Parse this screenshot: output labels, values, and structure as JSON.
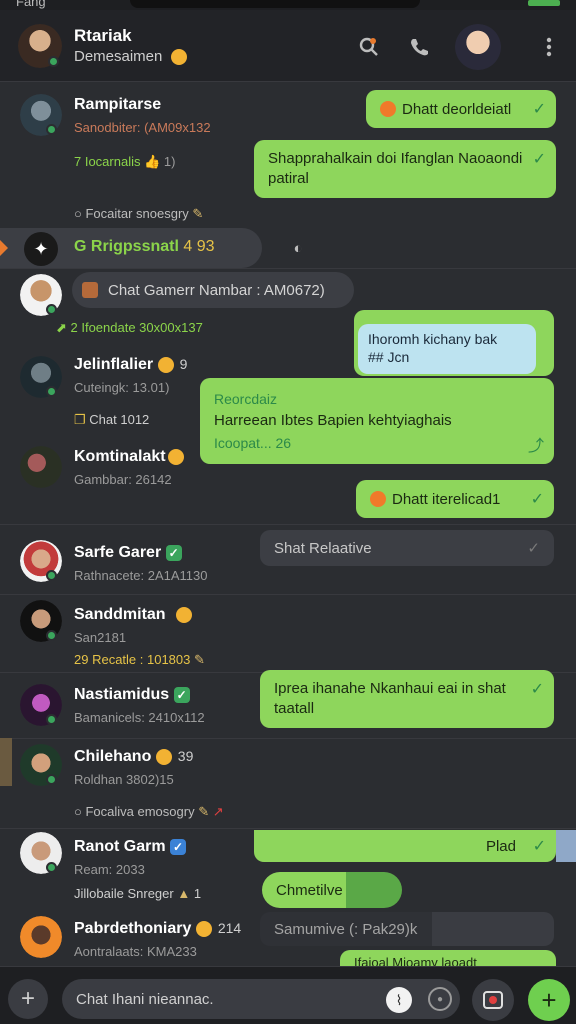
{
  "status": {
    "time": "Fang"
  },
  "header": {
    "title": "Rtariak",
    "subtitle": "Demesaimen"
  },
  "rows": [
    {
      "name": "Rampitarse",
      "meta": "Sanodbiter: (AM09x132",
      "meta2": "7 Iocarnalis",
      "meta2_count": "1)",
      "meta3": "Focaitar snoesgry"
    },
    {
      "name": "Rrigpssnatl",
      "count": "4 93"
    },
    {
      "name": "Chat Gamerr Nambar : AM0672)",
      "meta": "2 Ifoendate 30x00x137"
    },
    {
      "name": "Jelinflalier",
      "count": "9",
      "meta": "Cuteingk: 13.01)",
      "meta2": "Chat 1012"
    },
    {
      "name": "Komtinalakt",
      "meta": "Gambbar: 26142"
    },
    {
      "name": "Sarfe Garer",
      "meta": "Rathnacete: 2A1A1130"
    },
    {
      "name": "Sanddmitan",
      "meta": "San2181",
      "meta2": "29 Recatle : 101803"
    },
    {
      "name": "Nastiamidus",
      "meta": "Bamanicels: 2410x112"
    },
    {
      "name": "Chilehano",
      "count": "39",
      "meta": "Roldhan 3802)15",
      "meta2": "Focaliva emosogry"
    },
    {
      "name": "Ranot Garm",
      "meta": "Ream: 2033",
      "meta2": "Jillobaile Snreger",
      "meta2_count": "1"
    },
    {
      "name": "Pabrdethoniary",
      "count": "214",
      "meta": "Aontralaats: KMA233"
    }
  ],
  "bubbles": {
    "b1": "Dhatt deorldeiatl",
    "b2_line1": "Shapprahalkain doi Ifanglan Naoaondi",
    "b2_line2": "patiral",
    "b3": "",
    "b4_line1": "Ihoromh kichany bak",
    "b4_line2": "## Jcn",
    "b5_title": "Reorcdaiz",
    "b5_line": "Harreean Ibtes Bapien kehtyiaghais",
    "b5_footer": "Icoopat... 26",
    "b6": "Dhatt iterelicad1",
    "b7": "Shat Relaative",
    "b8_line1": "Iprea ihanahe Nkanhaui eai in shat",
    "b8_line2": "taatall",
    "b9": "Plad",
    "b10": "Chmetilve",
    "b11": "Samumive (: Pak29)k",
    "b12": "Ifaioal Mioamy laoadt"
  },
  "composer": {
    "placeholder": "Chat  Ihani nieannac."
  },
  "colors": {
    "accent_green": "#8ed65c",
    "online": "#3ba55d",
    "background": "#2b2d31"
  }
}
